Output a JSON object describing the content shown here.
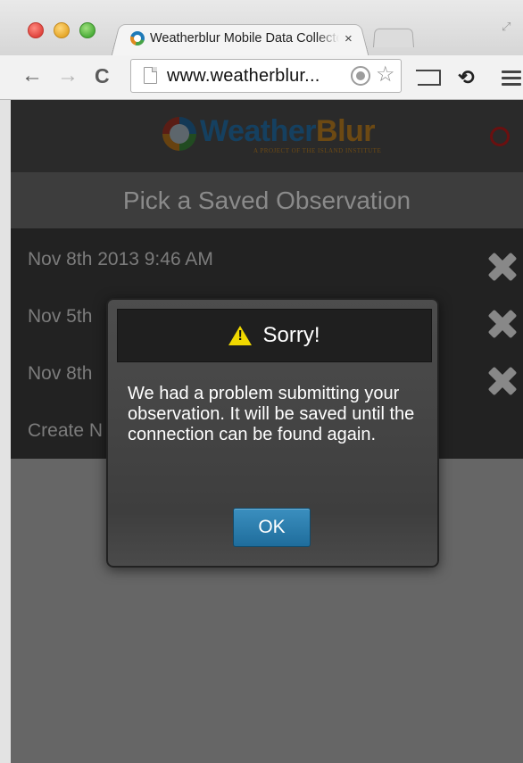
{
  "browser": {
    "tab_title": "Weatherblur Mobile Data Collector",
    "tab_close": "×",
    "url": "www.weatherblur...",
    "back_glyph": "←",
    "forward_glyph": "→",
    "reload_glyph": "C",
    "star_glyph": "☆",
    "extension_glyph": "⟲"
  },
  "app": {
    "logo_word_1": "Weather",
    "logo_word_2": "Blur",
    "logo_tagline": "A PROJECT OF THE ISLAND INSTITUTE",
    "page_title": "Pick a Saved Observation",
    "observations": [
      {
        "label": "Nov 8th 2013 9:46 AM"
      },
      {
        "label": "Nov 5th"
      },
      {
        "label": "Nov 8th"
      },
      {
        "label": "Create N"
      }
    ]
  },
  "modal": {
    "title": "Sorry!",
    "message": "We had a problem submitting your observation. It will be saved until the connection can be found again.",
    "ok_label": "OK"
  },
  "colors": {
    "warning": "#f0d800",
    "button": "#2a7fb0",
    "logo_blue": "#2f8fd6",
    "logo_orange": "#f0a32a"
  }
}
